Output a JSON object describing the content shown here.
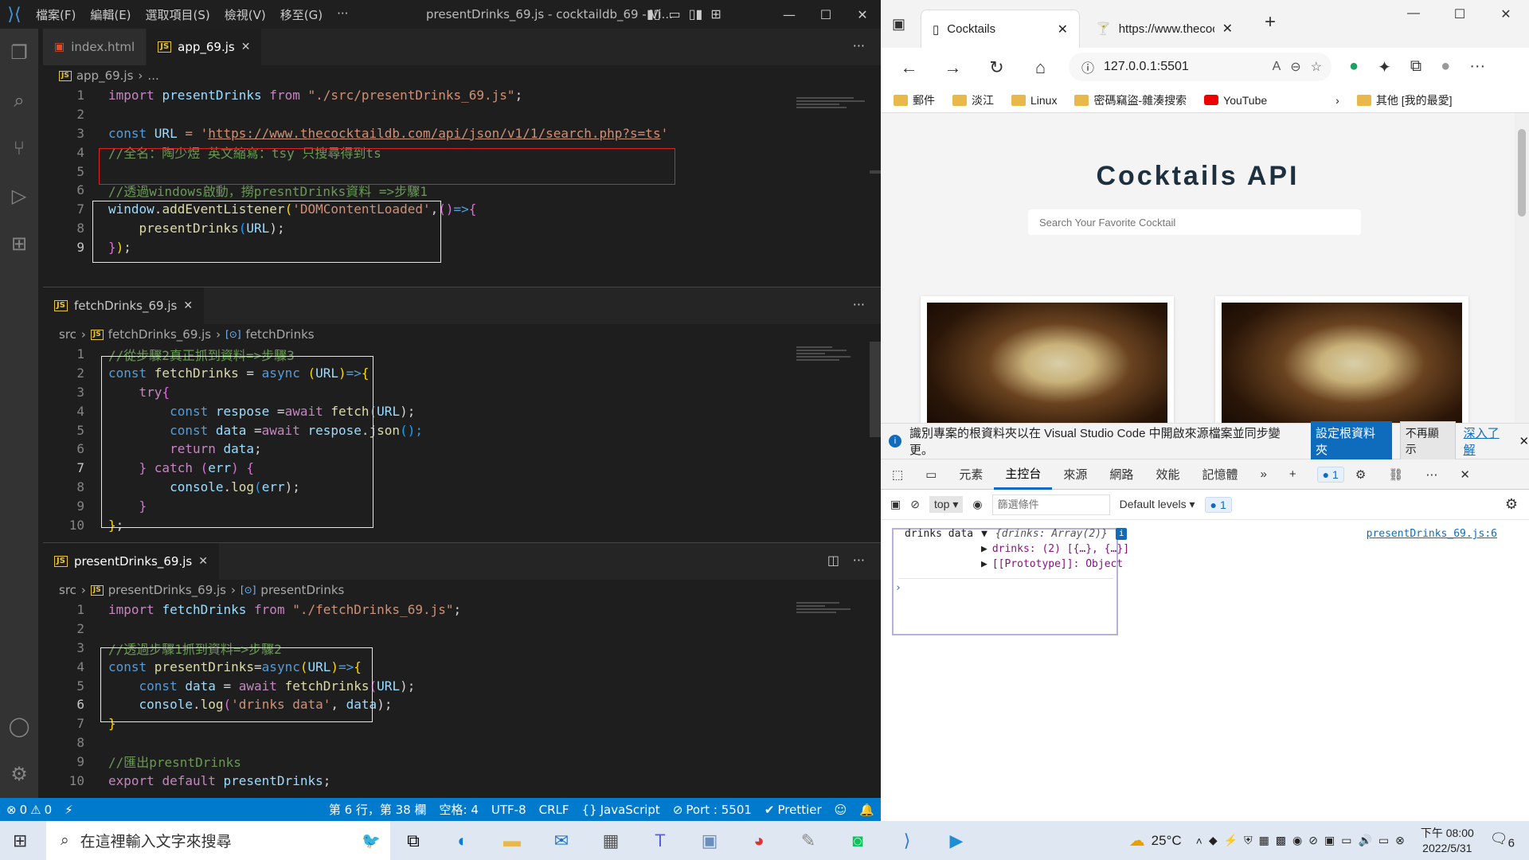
{
  "vscode": {
    "menu": [
      "檔案(F)",
      "編輯(E)",
      "選取項目(S)",
      "檢視(V)",
      "移至(G)",
      "···"
    ],
    "window_title": "presentDrinks_69.js - cocktaildb_69 - Vi...",
    "panes": [
      {
        "tabs": [
          {
            "label": "index.html",
            "icon": "html"
          },
          {
            "label": "app_69.js",
            "icon": "js",
            "active": true
          }
        ],
        "crumb": [
          "app_69.js",
          "..."
        ]
      },
      {
        "tabs": [
          {
            "label": "fetchDrinks_69.js",
            "icon": "js",
            "active": true
          }
        ],
        "crumb": [
          "src",
          "fetchDrinks_69.js",
          "fetchDrinks"
        ]
      },
      {
        "tabs": [
          {
            "label": "presentDrinks_69.js",
            "icon": "js",
            "active": true
          }
        ],
        "crumb": [
          "src",
          "presentDrinks_69.js",
          "presentDrinks"
        ]
      }
    ],
    "code1": {
      "l1": [
        "import ",
        "presentDrinks",
        " from ",
        "\"./src/presentDrinks_69.js\"",
        ";"
      ],
      "l3": [
        "const ",
        "URL",
        " = '",
        "https://www.thecocktaildb.com/api/json/v1/1/search.php?s=ts",
        "'"
      ],
      "l4": "//全名：陶少煜 英文縮寫：tsy 只搜尋得到ts",
      "l6": "//透過windows啟動，撈presntDrinks資料 =>步驟1",
      "l7": [
        "window",
        ".",
        "addEventListener",
        "(",
        "'DOMContentLoaded'",
        ",",
        "()",
        "=>",
        "{"
      ],
      "l8": [
        "presentDrinks",
        "(",
        "URL",
        ");"
      ],
      "l9": [
        "}",
        ")",
        ";"
      ]
    },
    "code2": {
      "l1": "//從步驟2真正抓到資料=>步驟3",
      "l2": [
        "const ",
        "fetchDrinks",
        " = ",
        "async ",
        "(",
        "URL",
        ")",
        "=>",
        "{"
      ],
      "l3": [
        "try",
        "{"
      ],
      "l4": [
        "const ",
        "respose",
        " =",
        "await ",
        "fetch",
        "(",
        "URL",
        ");"
      ],
      "l5": [
        "const ",
        "data",
        " =",
        "await ",
        "respose",
        ".",
        "json",
        "();"
      ],
      "l6": [
        "return ",
        "data",
        ";"
      ],
      "l7": [
        "} ",
        "catch ",
        "(",
        "err",
        ") ",
        "{"
      ],
      "l8": [
        "console",
        ".",
        "log",
        "(",
        "err",
        ");"
      ],
      "l9": "}",
      "l10": [
        "}",
        ";"
      ]
    },
    "code3": {
      "l1": [
        "import ",
        "fetchDrinks",
        " from ",
        "\"./fetchDrinks_69.js\"",
        ";"
      ],
      "l3": "//透過步驟1抓到資料=>步驟2",
      "l4": [
        "const ",
        "presentDrinks",
        "=",
        "async",
        "(",
        "URL",
        ")",
        "=>",
        "{"
      ],
      "l5": [
        "const ",
        "data",
        " = ",
        "await ",
        "fetchDrinks",
        "(",
        "URL",
        ");"
      ],
      "l6": [
        "console",
        ".",
        "log",
        "(",
        "'drinks data'",
        ", ",
        "data",
        ");"
      ],
      "l7": "}",
      "l9": "//匯出presntDrinks",
      "l10": [
        "export ",
        "default ",
        "presentDrinks",
        ";"
      ]
    },
    "status": {
      "errors": "0",
      "warnings": "0",
      "position": "第 6 行，第 38 欄",
      "spaces": "空格: 4",
      "encoding": "UTF-8",
      "eol": "CRLF",
      "language": "JavaScript",
      "port": "Port : 5501",
      "prettier": "Prettier"
    }
  },
  "browser": {
    "tabs": [
      {
        "label": "Cocktails"
      },
      {
        "label": "https://www.thecocktaildb"
      }
    ],
    "address": "127.0.0.1:5501",
    "favorites": [
      {
        "label": "郵件",
        "icon": "folder"
      },
      {
        "label": "淡江",
        "icon": "folder"
      },
      {
        "label": "Linux",
        "icon": "folder"
      },
      {
        "label": "密碼竊盜-雜湊搜索",
        "icon": "folder"
      },
      {
        "label": "YouTube",
        "icon": "youtube"
      }
    ],
    "favorites_other": "其他 [我的最愛]",
    "page": {
      "title": "Cocktails API",
      "search_placeholder": "Search Your Favorite Cocktail"
    },
    "infobar": {
      "text": "識別專案的根資料夾以在 Visual Studio Code 中開啟來源檔案並同步變更。",
      "primary": "設定根資料夾",
      "secondary": "不再顯示",
      "link": "深入了解"
    },
    "devtools": {
      "tabs": [
        "元素",
        "主控台",
        "來源",
        "網路",
        "效能",
        "記憶體"
      ],
      "active_tab": "主控台",
      "issues_count": "1",
      "context": "top",
      "filter_placeholder": "篩選條件",
      "levels": "Default levels",
      "msg_count": "1",
      "console": {
        "label": "drinks data",
        "obj": "{drinks: Array(2)}",
        "drinks_line": "drinks: (2) [{…}, {…}]",
        "proto_line": "[[Prototype]]: Object",
        "source": "presentDrinks_69.js:6"
      }
    }
  },
  "taskbar": {
    "search_placeholder": "在這裡輸入文字來搜尋",
    "weather": "25°C",
    "time": "下午 08:00",
    "date": "2022/5/31",
    "notif": "6"
  }
}
